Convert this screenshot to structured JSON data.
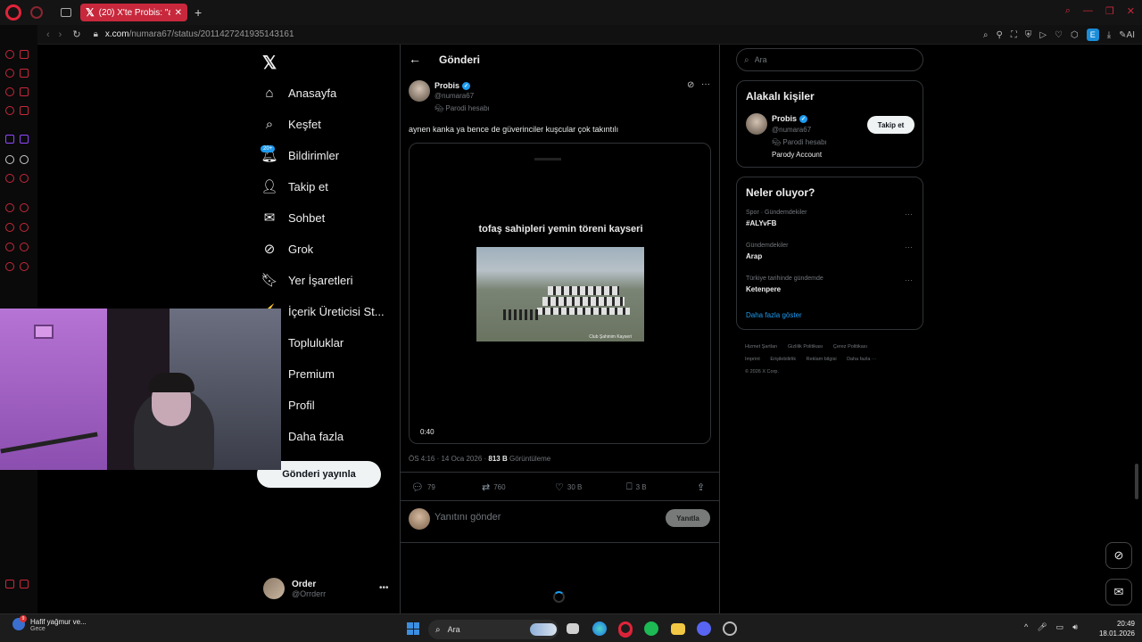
{
  "browser": {
    "tab_title": "(20) X'te Probis: \"aynen k...",
    "url_domain": "x.com",
    "url_path": "/numara67/status/2011427241935143161"
  },
  "nav": {
    "items": [
      {
        "label": "Anasayfa",
        "icon": "home-icon"
      },
      {
        "label": "Keşfet",
        "icon": "search-icon"
      },
      {
        "label": "Bildirimler",
        "icon": "bell-icon"
      },
      {
        "label": "Takip et",
        "icon": "person-add-icon"
      },
      {
        "label": "Sohbet",
        "icon": "mail-icon"
      },
      {
        "label": "Grok",
        "icon": "grok-icon"
      },
      {
        "label": "Yer İşaretleri",
        "icon": "bookmark-icon"
      },
      {
        "label": "İçerik Üreticisi St...",
        "icon": "creator-studio-icon"
      },
      {
        "label": "Topluluklar",
        "icon": "communities-icon"
      },
      {
        "label": "Premium",
        "icon": "premium-icon"
      },
      {
        "label": "Profil",
        "icon": "profile-icon"
      },
      {
        "label": "Daha fazla",
        "icon": "more-icon"
      }
    ],
    "notification_badge": "20+",
    "post_button": "Gönderi yayınla"
  },
  "account": {
    "name": "Order",
    "handle": "@Orrderr"
  },
  "header": {
    "title": "Gönderi"
  },
  "tweet": {
    "author_name": "Probis",
    "author_handle": "@numara67",
    "parody_label": "Parodi hesabı",
    "text": "aynen kanka ya bence de güverinciler kuşcular çok takıntılı",
    "video_caption": "tofaş sahipleri yemin töreni kayseri",
    "video_watermark": "Club Şahinim Kayseri",
    "video_duration": "0:40",
    "timestamp": "ÖS 4:16 · 14 Oca 2026 · ",
    "views_count": "813 B",
    "views_label": " Görüntüleme",
    "replies": "79",
    "reposts": "760",
    "likes": "30 B",
    "bookmarks": "3 B"
  },
  "reply": {
    "placeholder": "Yanıtını gönder",
    "button": "Yanıtla"
  },
  "search": {
    "placeholder": "Ara"
  },
  "related": {
    "title": "Alakalı kişiler",
    "name": "Probis",
    "handle": "@numara67",
    "parody_label": "Parodi hesabı",
    "bio": "Parody Account",
    "follow_button": "Takip et"
  },
  "trends": {
    "title": "Neler oluyor?",
    "items": [
      {
        "category": "Spor · Gündemdekiler",
        "name": "#ALYvFB"
      },
      {
        "category": "Gündemdekiler",
        "name": "Arap"
      },
      {
        "category": "Türkiye tarihinde gündemde",
        "name": "Ketenpere"
      }
    ],
    "show_more": "Daha fazla göster"
  },
  "footer": {
    "links": [
      "Hizmet Şartları",
      "Gizlilik Politikası",
      "Çerez Politikası",
      "Imprint",
      "Erişilebilirlik",
      "Reklam bilgisi",
      "Daha fazla ···"
    ],
    "copyright": "© 2026 X Corp."
  },
  "taskbar": {
    "weather_title": "Hafif yağmur ve...",
    "weather_sub": "Gece",
    "weather_badge": "9",
    "search": "Ara",
    "time": "20:49",
    "date": "18.01.2026"
  },
  "colors": {
    "accent": "#1d9bf0",
    "opera_red": "#c8283c",
    "background": "#000000"
  }
}
